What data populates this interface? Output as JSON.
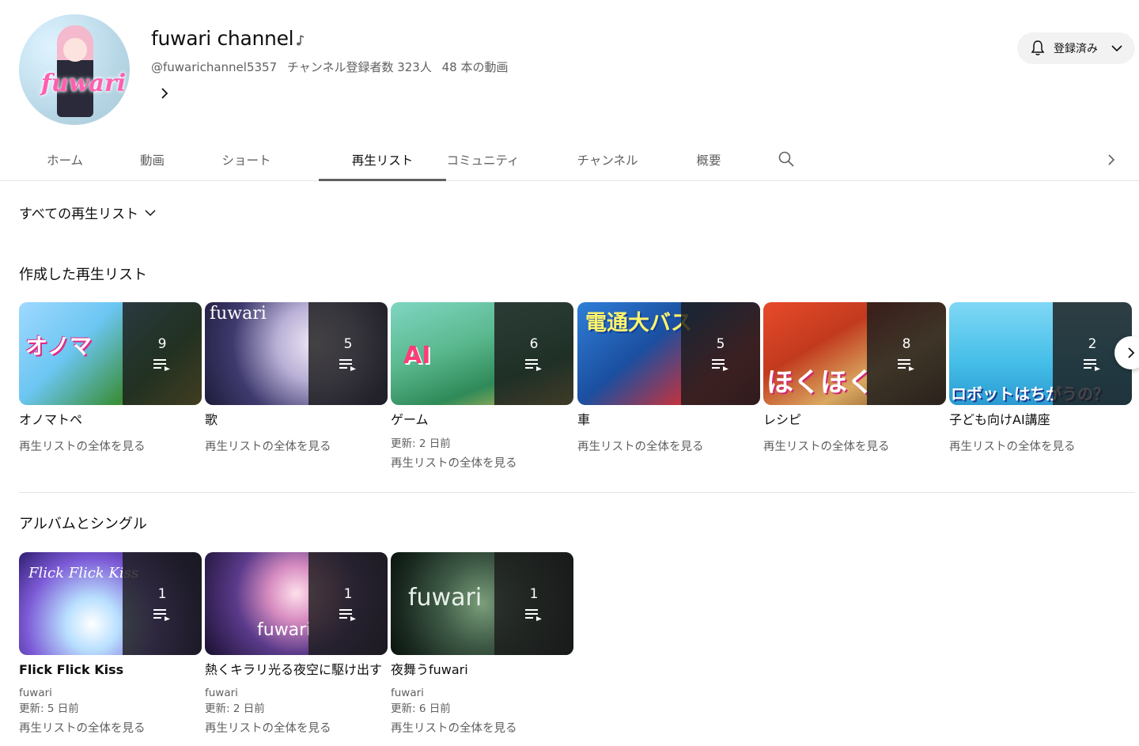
{
  "channel": {
    "title": "fuwari channel",
    "handle": "@fuwarichannel5357",
    "subscribers": "チャンネル登録者数 323人",
    "video_count": "48 本の動画",
    "subscribe_label": "登録済み",
    "avatar_logo": "fuwari"
  },
  "tabs": [
    {
      "label": "ホーム"
    },
    {
      "label": "動画"
    },
    {
      "label": "ショート"
    },
    {
      "label": "再生リスト",
      "active": true
    },
    {
      "label": "コミュニティ"
    },
    {
      "label": "チャンネル"
    },
    {
      "label": "概要"
    }
  ],
  "filter": {
    "label": "すべての再生リスト"
  },
  "sections": {
    "created": {
      "title": "作成した再生リスト",
      "items": [
        {
          "title": "オノマトペ",
          "count": "9",
          "updated": "",
          "view_all": "再生リストの全体を見る",
          "thumb_text": "オノマ"
        },
        {
          "title": "歌",
          "count": "5",
          "updated": "",
          "view_all": "再生リストの全体を見る",
          "thumb_text": "fuwari"
        },
        {
          "title": "ゲーム",
          "count": "6",
          "updated": "更新: 2 日前",
          "view_all": "再生リストの全体を見る",
          "thumb_text": "AI"
        },
        {
          "title": "車",
          "count": "5",
          "updated": "",
          "view_all": "再生リストの全体を見る",
          "thumb_text": "電通大バス"
        },
        {
          "title": "レシピ",
          "count": "8",
          "updated": "",
          "view_all": "再生リストの全体を見る",
          "thumb_text": "ほくほく"
        },
        {
          "title": "子ども向けAI講座",
          "count": "2",
          "updated": "",
          "view_all": "再生リストの全体を見る",
          "thumb_text": "ロボットはちがうの？"
        }
      ]
    },
    "albums": {
      "title": "アルバムとシングル",
      "items": [
        {
          "title": "Flick Flick Kiss",
          "count": "1",
          "artist": "fuwari",
          "updated": "更新: 5 日前",
          "view_all": "再生リストの全体を見る",
          "thumb_text": "Flick Flick Kiss"
        },
        {
          "title": "熱くキラリ光る夜空に駆け出す",
          "count": "1",
          "artist": "fuwari",
          "updated": "更新: 2 日前",
          "view_all": "再生リストの全体を見る",
          "thumb_text": "fuwari"
        },
        {
          "title": "夜舞うfuwari",
          "count": "1",
          "artist": "fuwari",
          "updated": "更新: 6 日前",
          "view_all": "再生リストの全体を見る",
          "thumb_text": "fuwari"
        }
      ]
    }
  },
  "colors": {
    "text": "#0f0f0f",
    "secondary": "#606060",
    "chip_bg": "#f2f2f2",
    "overlay": "#1c1c1c"
  }
}
